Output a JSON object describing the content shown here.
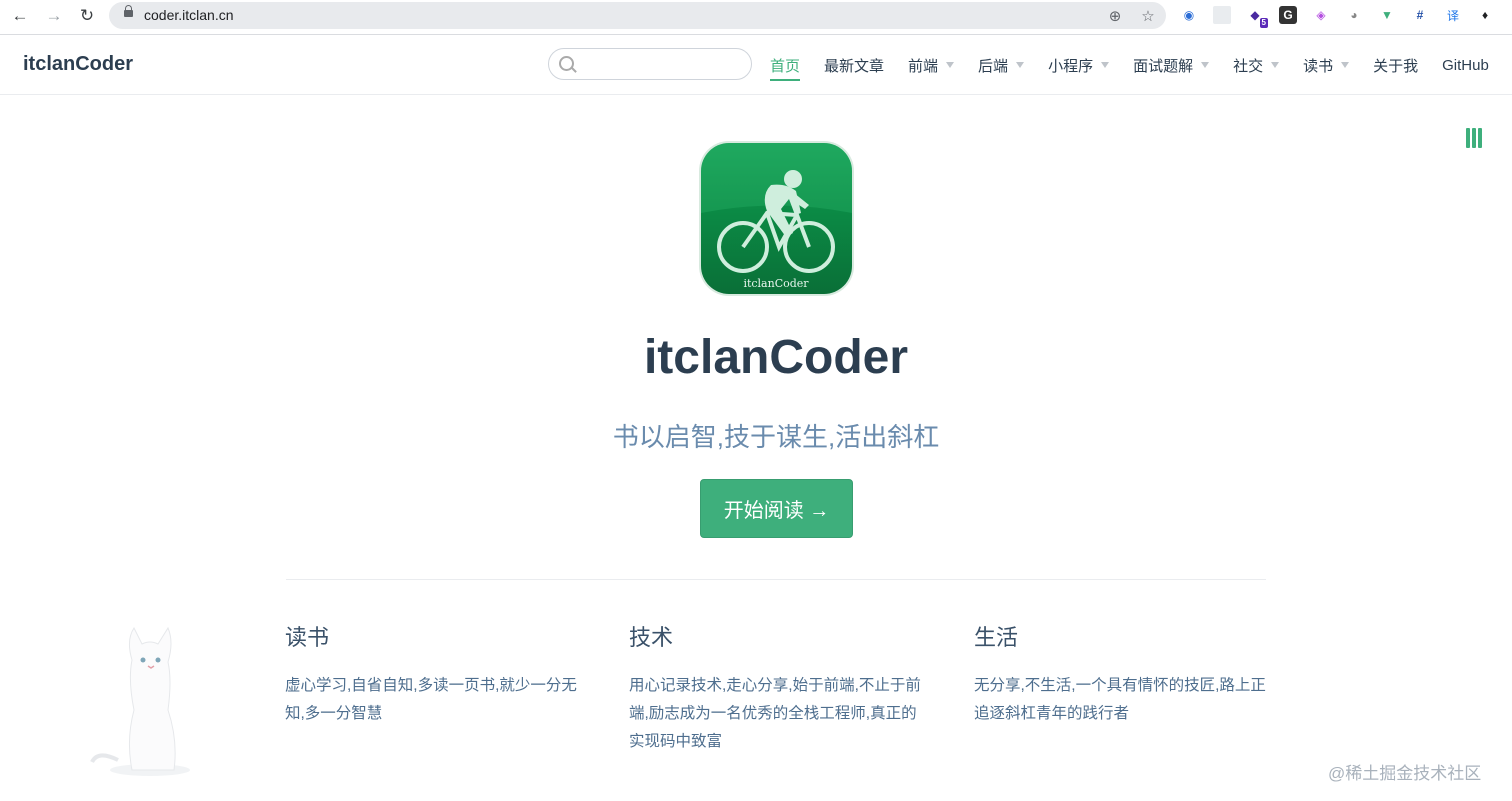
{
  "browser": {
    "url": "coder.itclan.cn",
    "extension_badge": "5",
    "extension_letters": [
      "G",
      "译"
    ]
  },
  "navbar": {
    "site_name": "itclanCoder",
    "search_placeholder": "",
    "links": [
      {
        "label": "首页",
        "active": true,
        "dropdown": false
      },
      {
        "label": "最新文章",
        "active": false,
        "dropdown": false
      },
      {
        "label": "前端",
        "active": false,
        "dropdown": true
      },
      {
        "label": "后端",
        "active": false,
        "dropdown": true
      },
      {
        "label": "小程序",
        "active": false,
        "dropdown": true
      },
      {
        "label": "面试题解",
        "active": false,
        "dropdown": true
      },
      {
        "label": "社交",
        "active": false,
        "dropdown": true
      },
      {
        "label": "读书",
        "active": false,
        "dropdown": true
      },
      {
        "label": "关于我",
        "active": false,
        "dropdown": false
      },
      {
        "label": "GitHub",
        "active": false,
        "dropdown": false
      }
    ]
  },
  "hero": {
    "logo_caption": "itclanCoder",
    "title": "itclanCoder",
    "description": "书以启智,技于谋生,活出斜杠",
    "action_label": "开始阅读 →"
  },
  "features": [
    {
      "title": "读书",
      "details": "虚心学习,自省自知,多读一页书,就少一分无知,多一分智慧"
    },
    {
      "title": "技术",
      "details": "用心记录技术,走心分享,始于前端,不止于前端,励志成为一名优秀的全栈工程师,真正的实现码中致富"
    },
    {
      "title": "生活",
      "details": "无分享,不生活,一个具有情怀的技匠,路上正追逐斜杠青年的践行者"
    }
  ],
  "watermark": "@稀土掘金技术社区",
  "colors": {
    "accent": "#3eaf7c",
    "text": "#2c3e50",
    "desc": "#6a8bad"
  }
}
